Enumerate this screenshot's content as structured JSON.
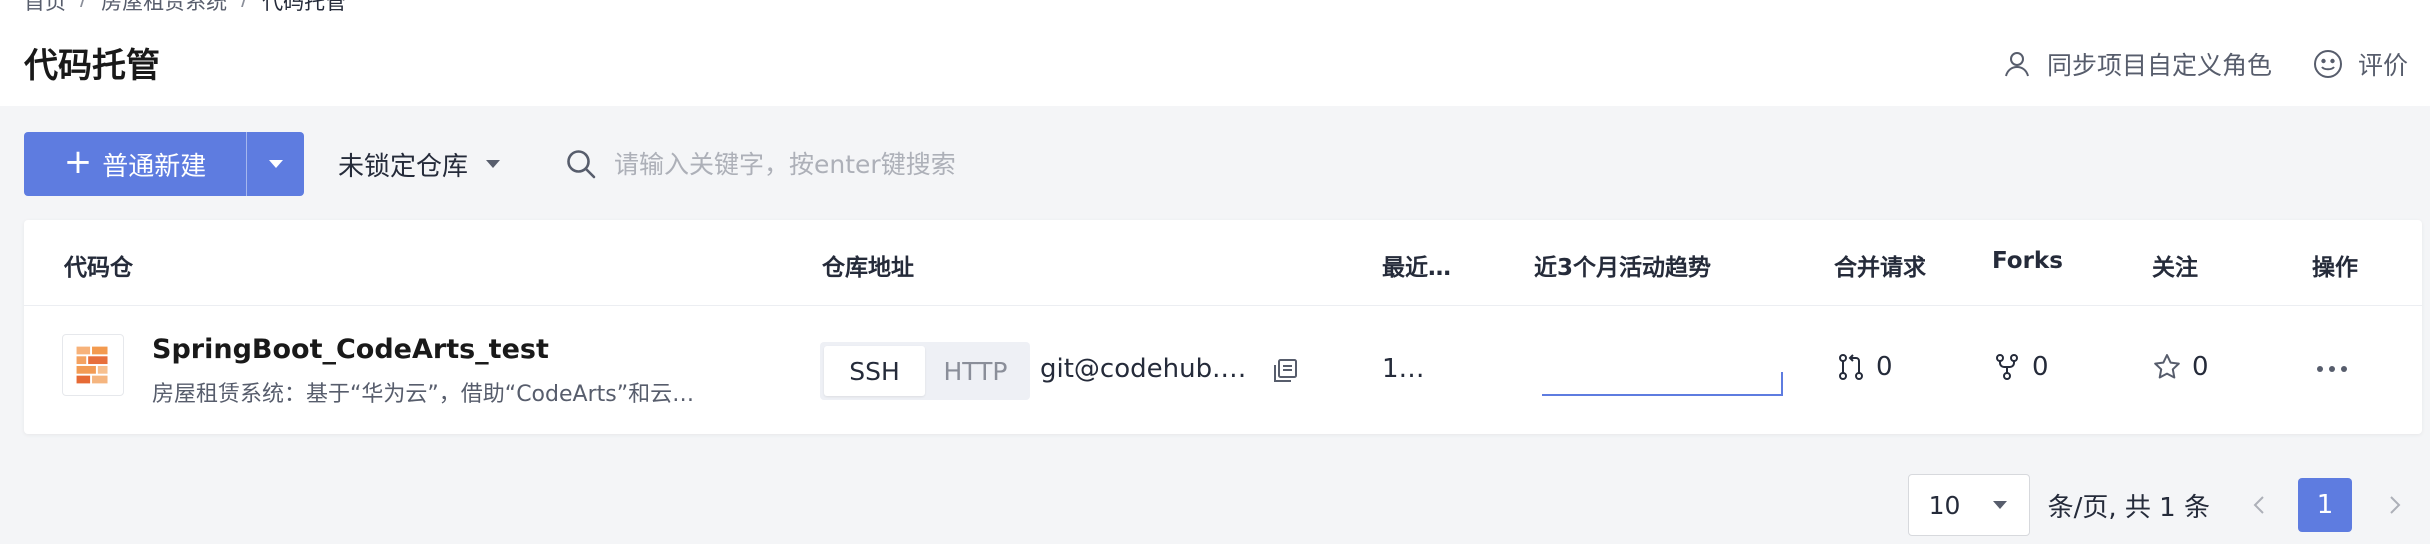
{
  "breadcrumb": {
    "home": "首页",
    "project": "房屋租赁系统",
    "current": "代码托管",
    "separator": "/"
  },
  "page": {
    "title": "代码托管"
  },
  "top_actions": {
    "sync_label": "同步项目自定义角色",
    "rate_label": "评价"
  },
  "toolbar": {
    "new_label": "普通新建",
    "lock_filter": "未锁定仓库",
    "search_placeholder": "请输入关键字，按enter键搜索"
  },
  "table": {
    "headers": {
      "repo": "代码仓",
      "address": "仓库地址",
      "recent": "最近…",
      "trend": "近3个月活动趋势",
      "merge": "合并请求",
      "forks": "Forks",
      "follow": "关注",
      "ops": "操作"
    },
    "rows": [
      {
        "name": "SpringBoot_CodeArts_test",
        "description": "房屋租赁系统：基于“华为云”，借助“CodeArts”和云…",
        "protocols": [
          "SSH",
          "HTTP"
        ],
        "active_protocol": "SSH",
        "url": "git@codehub.d…",
        "recent": "1…",
        "merge_requests": "0",
        "forks": "0",
        "follows": "0"
      }
    ]
  },
  "pagination": {
    "page_size": "10",
    "summary": "条/页, 共 1 条",
    "current_page": "1"
  },
  "colors": {
    "primary": "#5e7ce0",
    "text": "#252b3a",
    "muted": "#575d6c",
    "background": "#f4f5f7"
  }
}
